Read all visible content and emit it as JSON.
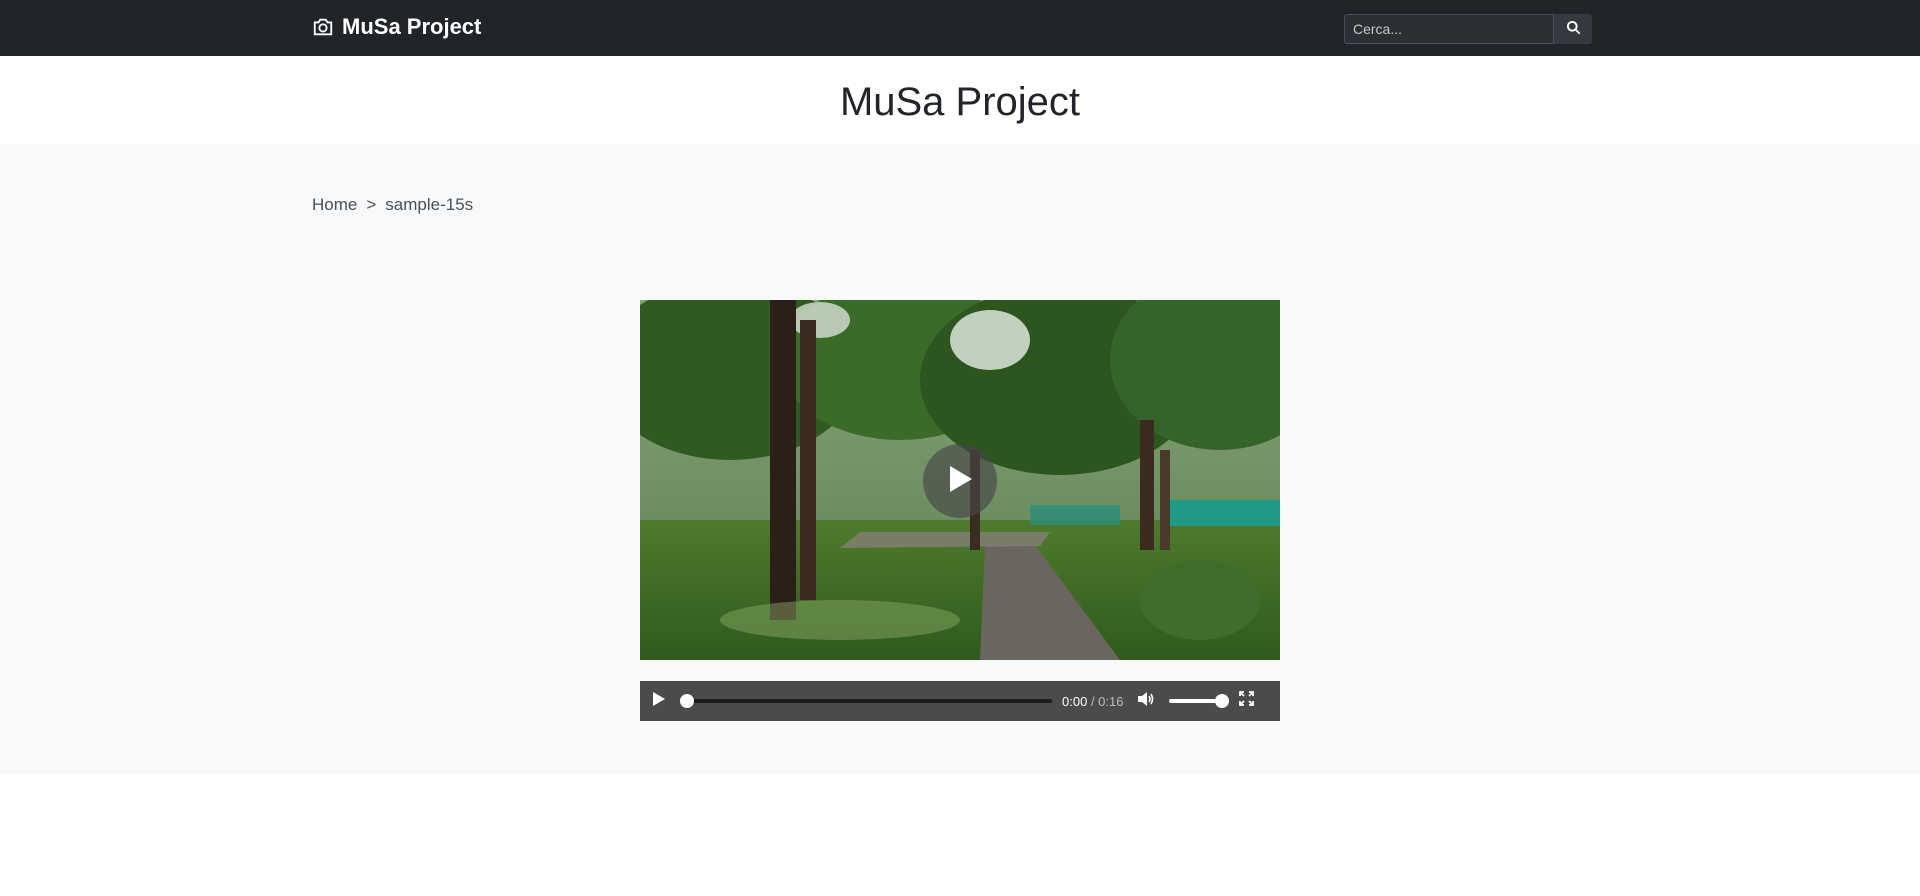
{
  "navbar": {
    "brand_label": "MuSa Project",
    "brand_icon": "camera-icon",
    "search": {
      "placeholder": "Cerca...",
      "value": "",
      "button_icon": "search-icon"
    }
  },
  "header": {
    "title": "MuSa Project"
  },
  "breadcrumb": {
    "home": "Home",
    "separator": ">",
    "current": "sample-15s"
  },
  "video": {
    "current_time": "0:00",
    "duration": "/ 0:16",
    "progress": 0,
    "volume": 1,
    "play_icon": "play-icon",
    "volume_icon": "volume-icon",
    "fullscreen_icon": "fullscreen-icon"
  },
  "colors": {
    "navbar_bg": "#212529",
    "main_bg": "#f8f9fa",
    "controls_bg": "#4b4b4b"
  }
}
